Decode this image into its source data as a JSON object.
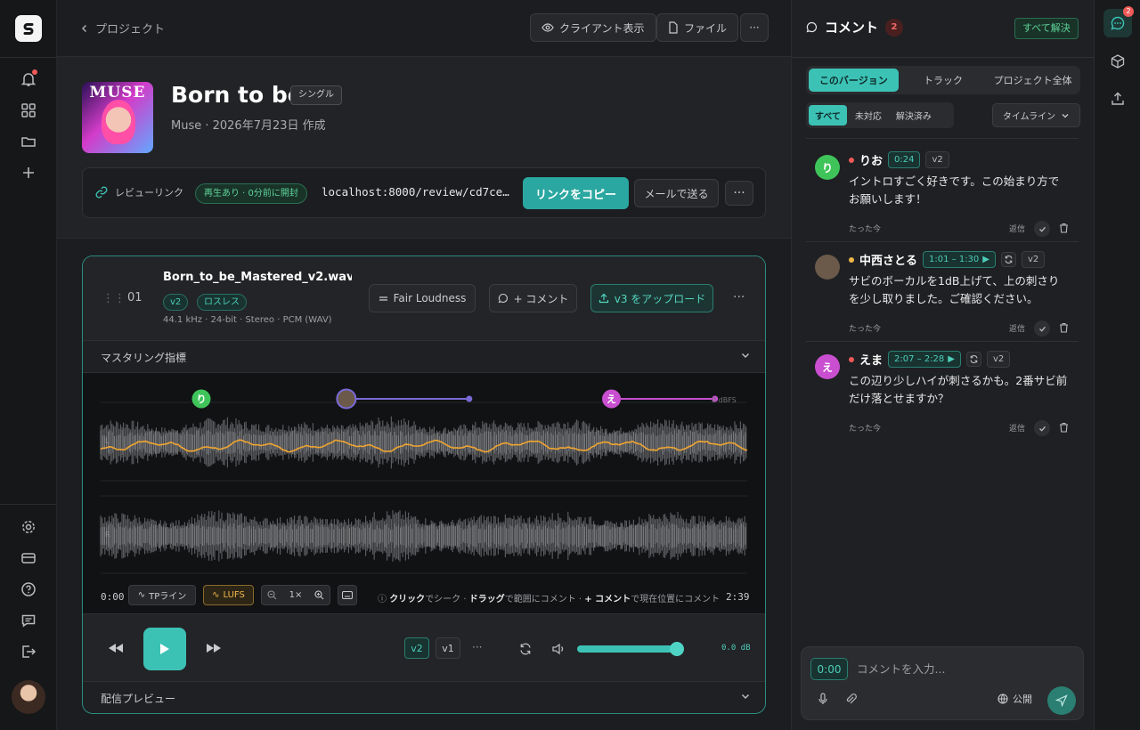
{
  "topbar": {
    "back_label": "プロジェクト",
    "client_view_label": "クライアント表示",
    "file_label": "ファイル",
    "more_label": "···"
  },
  "cover": {
    "text": "MUSE"
  },
  "project": {
    "title": "Born to be",
    "type_badge": "シングル",
    "subtitle": "Muse · 2026年7月23日 作成"
  },
  "review_link": {
    "label": "レビューリンク",
    "status": "再生あり · 0分前に開封",
    "url": "localhost:8000/review/cd7ce…",
    "copy_label": "リンクをコピー",
    "mail_label": "メールで送る",
    "more_label": "···"
  },
  "track": {
    "number": "01",
    "filename": "Born_to_be_Mastered_v2.wav · …",
    "version_tag": "v2",
    "quality_tag": "ロスレス",
    "meta": "44.1 kHz · 24-bit · Stereo · PCM (WAV)",
    "fair_loudness_label": "Fair Loudness",
    "comment_label": "+ コメント",
    "upload_label": "v3 をアップロード",
    "more_label": "···",
    "mastering_label": "マスタリング指標"
  },
  "waveform": {
    "markers": [
      {
        "initial": "り",
        "color": "#3fc45a",
        "start": 0.0
      },
      {
        "initial": "",
        "color": "#7a6ad8",
        "start": 0.38,
        "end": 0.57
      },
      {
        "initial": "え",
        "color": "#c94fd0",
        "start": 0.79,
        "end": 0.95
      }
    ],
    "level_label": "0 dBFS",
    "channel_left": "L",
    "channel_right": "R"
  },
  "controls": {
    "time_start": "0:00",
    "tp_label": "TPライン",
    "lufs_label": "LUFS",
    "zoom_label": "1×",
    "hint_html": [
      {
        "b": "クリック",
        "t": "でシーク · "
      },
      {
        "b": "ドラッグ",
        "t": "で範囲にコメント · "
      },
      {
        "b": "+ コメント",
        "t": "で現在位置にコメント"
      }
    ],
    "time_end": "2:39"
  },
  "player": {
    "versions": [
      "v2",
      "v1"
    ],
    "more_label": "···",
    "volume": 0.93,
    "db_label": "0.0 dB",
    "distribution_label": "配信プレビュー"
  },
  "comments_panel": {
    "title": "コメント",
    "count": "2",
    "resolve_all": "すべて解決",
    "scope_tabs": [
      "このバージョン",
      "トラック",
      "プロジェクト全体"
    ],
    "filter_tabs": [
      "すべて",
      "未対応",
      "解決済み"
    ],
    "sort_label": "タイムライン",
    "comments": [
      {
        "initial": "り",
        "avatar_color": "#3fc45a",
        "status_color": "#ee5a58",
        "author": "りお",
        "timecode": "0:24",
        "version": "v2",
        "loop": false,
        "text": "イントロすごく好きです。この始まり方でお願いします！",
        "time_ago": "たった今",
        "reply_label": "返信"
      },
      {
        "initial": "",
        "avatar_color": "#6b5a4a",
        "status_color": "#f0b649",
        "author": "中西さとる",
        "timecode": "1:01 – 1:30",
        "version": "v2",
        "loop": true,
        "text": "サビのボーカルを1dB上げて、上の刺さりを少し取りました。ご確認ください。",
        "time_ago": "たった今",
        "reply_label": "返信"
      },
      {
        "initial": "え",
        "avatar_color": "#c94fd0",
        "status_color": "#ee5a58",
        "author": "えま",
        "timecode": "2:07 – 2:28",
        "version": "v2",
        "loop": true,
        "text": "この辺り少しハイが刺さるかも。2番サビ前だけ落とせますか？",
        "time_ago": "たった今",
        "reply_label": "返信"
      }
    ],
    "compose": {
      "time": "0:00",
      "placeholder": "コメントを入力...",
      "visibility": "公開"
    }
  },
  "right_rail": {
    "badge": "2"
  },
  "colors": {
    "accent": "#3cc2b5",
    "lufs": "#f0a530",
    "wave": "#5a5b5e"
  }
}
